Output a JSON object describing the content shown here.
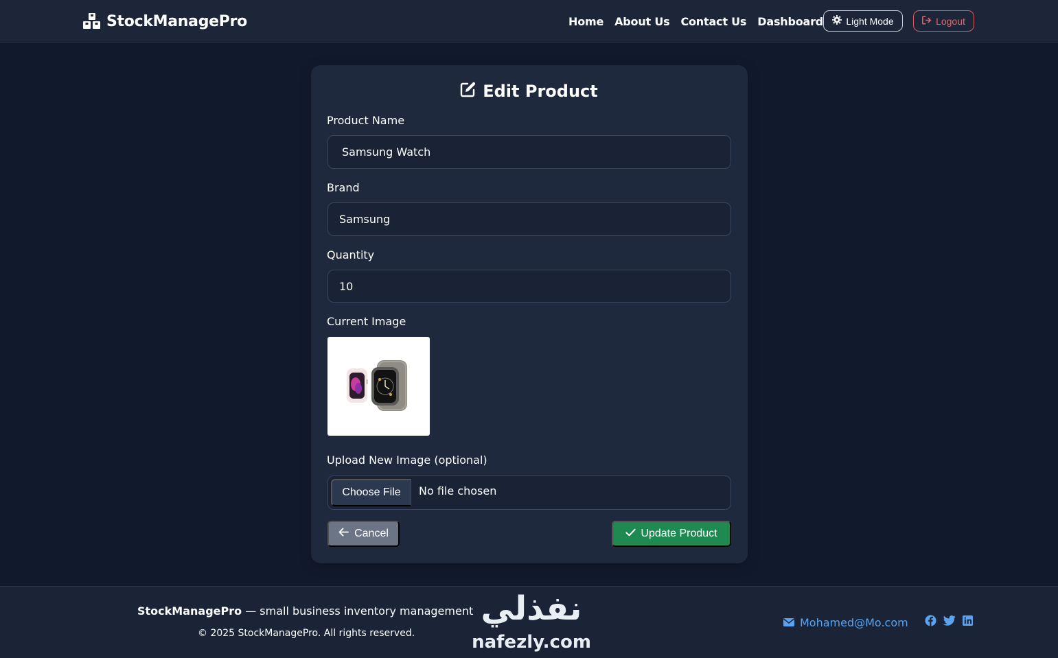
{
  "navbar": {
    "brand": "StockManagePro",
    "links": [
      "Home",
      "About Us",
      "Contact Us",
      "Dashboard"
    ],
    "mode_button": "Light Mode",
    "logout_button": "Logout"
  },
  "form": {
    "title": "Edit Product",
    "product_name_label": "Product Name",
    "product_name_value": "Samsung Watch",
    "brand_label": "Brand",
    "brand_value": "Samsung",
    "quantity_label": "Quantity",
    "quantity_value": "10",
    "current_image_label": "Current Image",
    "upload_label": "Upload New Image (optional)",
    "choose_file_button": "Choose File",
    "file_status": "No file chosen",
    "cancel_button": "Cancel",
    "update_button": "Update Product"
  },
  "footer": {
    "brand": "StockManagePro",
    "tagline": "— small business inventory management",
    "copyright": "© 2025 StockManagePro. All rights reserved.",
    "email": "Mohamed@Mo.com",
    "socials": [
      "facebook-icon",
      "twitter-icon",
      "linkedin-icon"
    ]
  },
  "watermark": {
    "arabic": "نفذلي",
    "latin": "nafezly.com"
  },
  "colors": {
    "page_bg": "#111a2d",
    "card_bg": "#1f293d",
    "success": "#1e8a52",
    "danger": "#e05a63",
    "link": "#5aa3f0"
  }
}
